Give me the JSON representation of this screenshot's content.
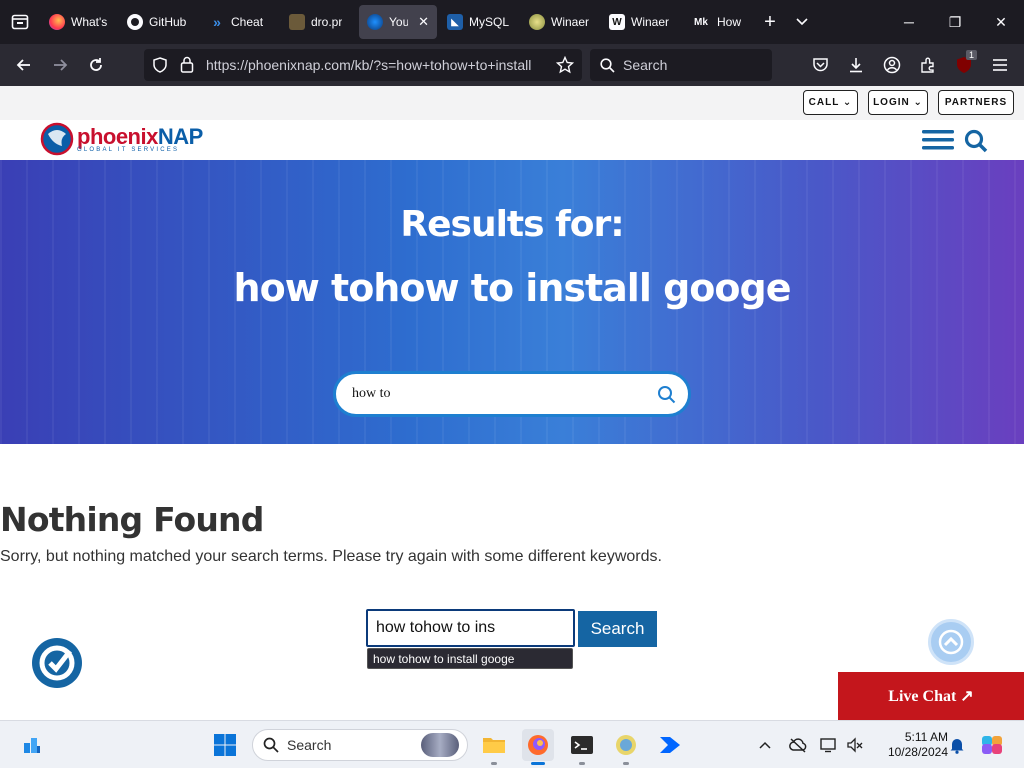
{
  "browser": {
    "tabs": [
      {
        "title": "What's",
        "favicon": "firefox-icon"
      },
      {
        "title": "GitHub",
        "favicon": "github-icon"
      },
      {
        "title": "Cheat",
        "favicon": "chevron-icon"
      },
      {
        "title": "dro.pr",
        "favicon": "image-icon"
      },
      {
        "title": "You",
        "favicon": "phoenixnap-icon",
        "active": true,
        "close": "✕"
      },
      {
        "title": "MySQL",
        "favicon": "mysql-icon"
      },
      {
        "title": "Winaer",
        "favicon": "winaero-icon"
      },
      {
        "title": "Winaer",
        "favicon": "w-icon",
        "badge": "W"
      },
      {
        "title": "How I",
        "favicon": "mk-icon",
        "badge": "Mk"
      }
    ],
    "url": "https://phoenixnap.com/kb/?s=how+tohow+to+install",
    "search_placeholder": "Search",
    "notification_count": "1"
  },
  "site": {
    "util_buttons": {
      "call": "CALL ⌄",
      "login": "LOGIN ⌄",
      "partners": "PARTNERS"
    },
    "logo": {
      "brand_a": "phoenix",
      "brand_b": "NAP",
      "tagline": "GLOBAL IT SERVICES"
    },
    "hero": {
      "line1": "Results for:",
      "line2": "how tohow to install googe",
      "search_value": "how to"
    },
    "nothing_found_title": "Nothing Found",
    "nothing_found_text": "Sorry, but nothing matched your search terms. Please try again with some different keywords.",
    "search_value": "how tohow to ins",
    "search_button": "Search",
    "autocomplete": "how tohow to install googe",
    "live_chat": "Live Chat ↗"
  },
  "taskbar": {
    "search_label": "Search",
    "time": "5:11 AM",
    "date": "10/28/2024"
  },
  "colors": {
    "brand_red": "#c8102e",
    "brand_blue": "#0b5ea8",
    "button_blue": "#1565a3",
    "live_chat_red": "#c4161c"
  }
}
